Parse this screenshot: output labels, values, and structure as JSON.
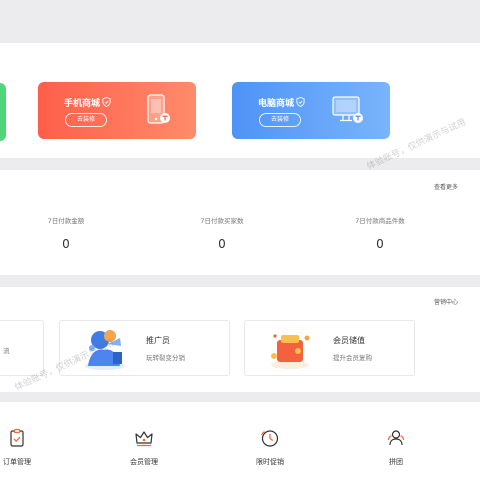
{
  "shop_cards": [
    {
      "title": "手机商城",
      "button": "去装修",
      "color": "#ff6a50"
    },
    {
      "title": "电脑商城",
      "button": "去装修",
      "color": "#5a9cf8"
    }
  ],
  "stats": {
    "more_link": "查看更多",
    "items": [
      {
        "label": "7日付款金额",
        "value": "0"
      },
      {
        "label": "7日付款买家数",
        "value": "0"
      },
      {
        "label": "7日付款商品件数",
        "value": "0"
      }
    ]
  },
  "marketing": {
    "center_link": "营销中心",
    "partial_card_text": "流",
    "cards": [
      {
        "title": "推广员",
        "subtitle": "玩转裂变分销"
      },
      {
        "title": "会员储值",
        "subtitle": "提升会员复购"
      }
    ]
  },
  "tools": [
    {
      "label": "订单管理",
      "icon": "clipboard-check-icon"
    },
    {
      "label": "会员管理",
      "icon": "crown-icon"
    },
    {
      "label": "限时促销",
      "icon": "clock-icon"
    },
    {
      "label": "拼团",
      "icon": "group-icon"
    }
  ],
  "watermark": "体验账号，仅供演示与试用"
}
